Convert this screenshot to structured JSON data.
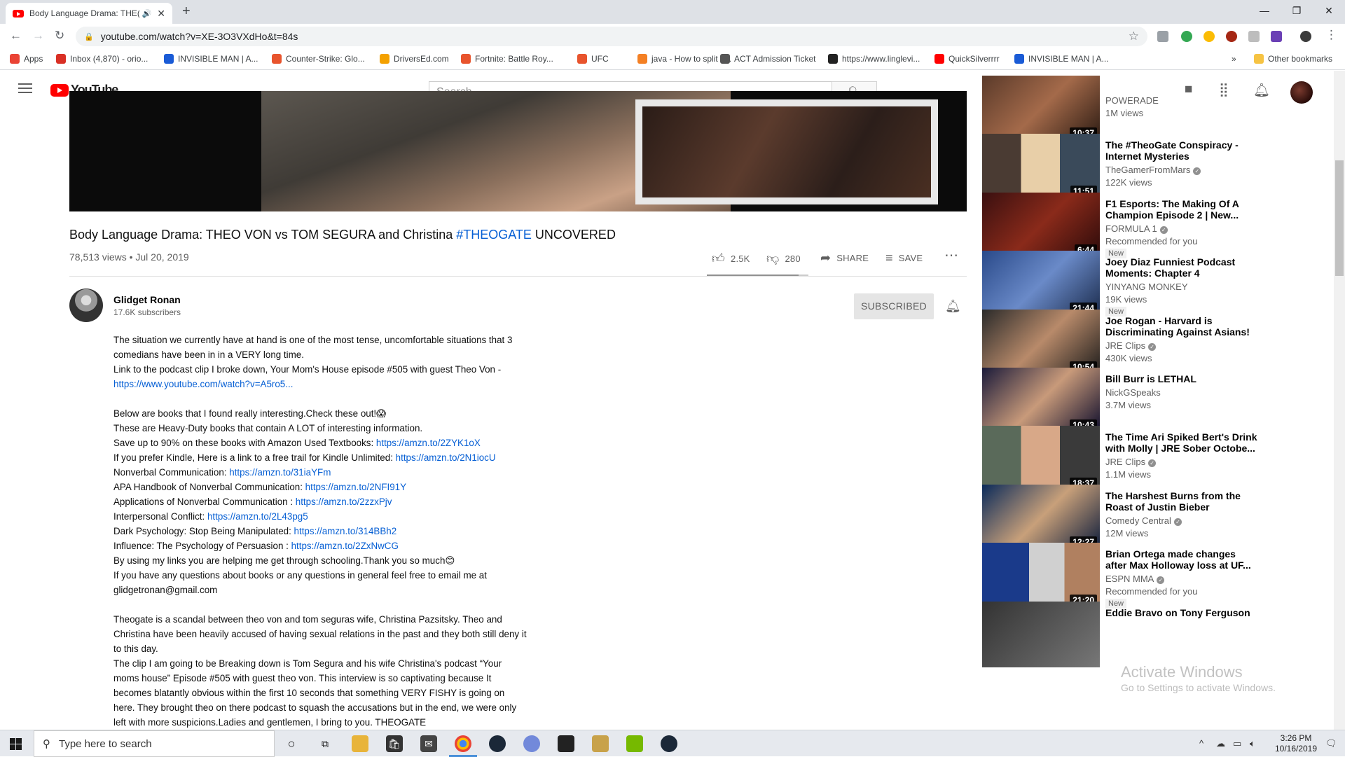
{
  "browser": {
    "tab_title": "Body Language Drama: THE(",
    "url": "youtube.com/watch?v=XE-3O3VXdHo&t=84s",
    "bookmarks": [
      {
        "label": "Apps",
        "color": "#ea4335"
      },
      {
        "label": "Inbox (4,870) - orio...",
        "color": "#d93025"
      },
      {
        "label": "INVISIBLE MAN | A...",
        "color": "#1a5bd6"
      },
      {
        "label": "Counter-Strike: Glo...",
        "color": "#e8542d"
      },
      {
        "label": "DriversEd.com",
        "color": "#f4a100"
      },
      {
        "label": "Fortnite: Battle Roy...",
        "color": "#e8542d"
      },
      {
        "label": "UFC",
        "color": "#e8542d"
      },
      {
        "label": "java - How to split s...",
        "color": "#f48024"
      },
      {
        "label": "ACT Admission Ticket",
        "color": "#555555"
      },
      {
        "label": "https://www.linglevi...",
        "color": "#222222"
      },
      {
        "label": "QuickSilverrrr",
        "color": "#ff0000"
      },
      {
        "label": "INVISIBLE MAN | A...",
        "color": "#1a5bd6"
      }
    ],
    "bookmarks_overflow": "»",
    "other_bookmarks": "Other bookmarks"
  },
  "youtube": {
    "logo_text": "YouTube",
    "search_placeholder": "Search",
    "video": {
      "title_main": "Body Language Drama: THEO VON vs TOM SEGURA and Christina ",
      "title_tag": "#THEOGATE",
      "title_end": " UNCOVERED",
      "meta": "78,513 views • Jul 20, 2019",
      "likes": "2.5K",
      "dislikes": "280",
      "share_label": "SHARE",
      "save_label": "SAVE",
      "like_ratio": 0.9
    },
    "channel": {
      "name": "Glidget Ronan",
      "subscribers": "17.6K subscribers",
      "subscribe_label": "SUBSCRIBED"
    },
    "description": [
      {
        "t": "The situation we currently have at hand is one of the most tense, uncomfortable situations that 3"
      },
      {
        "t": "comedians have been in in a VERY long time."
      },
      {
        "t": "Link to the podcast clip I broke down, Your Mom's House episode #505 with guest Theo Von -"
      },
      {
        "t": "",
        "link": "https://www.youtube.com/watch?v=A5ro5..."
      },
      {
        "gap": true
      },
      {
        "t": "Below are books that I found really interesting.Check these out!😱"
      },
      {
        "t": "These are Heavy-Duty books that contain A LOT of interesting information."
      },
      {
        "t": "Save up to 90% on these books with Amazon Used Textbooks: ",
        "link": "https://amzn.to/2ZYK1oX"
      },
      {
        "t": "If you prefer Kindle, Here is a link to a free trail for Kindle Unlimited: ",
        "link": "https://amzn.to/2N1iocU"
      },
      {
        "t": "Nonverbal Communication: ",
        "link": "https://amzn.to/31iaYFm"
      },
      {
        "t": "APA Handbook of Nonverbal Communication: ",
        "link": "https://amzn.to/2NFI91Y"
      },
      {
        "t": "Applications of Nonverbal Communication : ",
        "link": "https://amzn.to/2zzxPjv"
      },
      {
        "t": "Interpersonal Conflict: ",
        "link": "https://amzn.to/2L43pg5"
      },
      {
        "t": "Dark Psychology: Stop Being Manipulated: ",
        "link": "https://amzn.to/314BBh2"
      },
      {
        "t": "Influence: The Psychology of Persuasion : ",
        "link": "https://amzn.to/2ZxNwCG"
      },
      {
        "t": "By using my links you are helping me get through schooling.Thank you so much😊"
      },
      {
        "t": "If you have any questions about books or any questions in general feel free to email me at"
      },
      {
        "t": "glidgetronan@gmail.com"
      },
      {
        "gap": true
      },
      {
        "t": "Theogate is a scandal between theo von and tom seguras wife, Christina Pazsitsky. Theo and"
      },
      {
        "t": "Christina have been heavily accused of having sexual relations in the past and they both still deny it"
      },
      {
        "t": "to this day."
      },
      {
        "t": "The clip I am going to be Breaking down is Tom Segura and his wife Christina's podcast “Your"
      },
      {
        "t": "moms house” Episode #505 with guest theo von. This interview is so captivating because It"
      },
      {
        "t": "becomes blatantly obvious within the first 10 seconds that something VERY FISHY is going on"
      },
      {
        "t": "here. They brought theo on there podcast to squash the accusations but in the end, we were only"
      },
      {
        "t": "left with more suspicions.Ladies and gentlemen, I bring to you. THEOGATE"
      }
    ],
    "sidebar": [
      {
        "title": "",
        "channel": "POWERADE",
        "views": "1M views",
        "duration": "10:37",
        "verified": false,
        "rec": "",
        "new": ""
      },
      {
        "title": "The #TheoGate Conspiracy - Internet Mysteries",
        "channel": "TheGamerFromMars",
        "views": "122K views",
        "duration": "11:51",
        "verified": true,
        "rec": "",
        "new": ""
      },
      {
        "title": "F1 Esports: The Making Of A Champion Episode 2 | New...",
        "channel": "FORMULA 1",
        "views": "",
        "duration": "6:44",
        "verified": true,
        "rec": "Recommended for you",
        "new": "New"
      },
      {
        "title": "Joey Diaz Funniest Podcast Moments: Chapter 4",
        "channel": "YINYANG MONKEY",
        "views": "19K views",
        "duration": "21:44",
        "verified": false,
        "rec": "",
        "new": "New"
      },
      {
        "title": "Joe Rogan - Harvard is Discriminating Against Asians!",
        "channel": "JRE Clips",
        "views": "430K views",
        "duration": "10:54",
        "verified": true,
        "rec": "",
        "new": ""
      },
      {
        "title": "Bill Burr is LETHAL",
        "channel": "NickGSpeaks",
        "views": "3.7M views",
        "duration": "10:43",
        "verified": false,
        "rec": "",
        "new": ""
      },
      {
        "title": "The Time Ari Spiked Bert's Drink with Molly | JRE Sober Octobe...",
        "channel": "JRE Clips",
        "views": "1.1M views",
        "duration": "18:37",
        "verified": true,
        "rec": "",
        "new": ""
      },
      {
        "title": "The Harshest Burns from the Roast of Justin Bieber",
        "channel": "Comedy Central",
        "views": "12M views",
        "duration": "12:27",
        "verified": true,
        "rec": "",
        "new": ""
      },
      {
        "title": "Brian Ortega made changes after Max Holloway loss at UF...",
        "channel": "ESPN MMA",
        "views": "",
        "duration": "21:20",
        "verified": true,
        "rec": "Recommended for you",
        "new": "New"
      },
      {
        "title": "Eddie Bravo on Tony Ferguson",
        "channel": "",
        "views": "",
        "duration": "",
        "verified": false,
        "rec": "",
        "new": ""
      }
    ],
    "activate_title": "Activate Windows",
    "activate_sub": "Go to Settings to activate Windows."
  },
  "taskbar": {
    "search_placeholder": "Type here to search",
    "time": "3:26 PM",
    "date": "10/16/2019"
  },
  "colors": {
    "yt_red": "#ff0000",
    "link_blue": "#065fd4",
    "chrome_tabstrip": "#dee1e6"
  }
}
